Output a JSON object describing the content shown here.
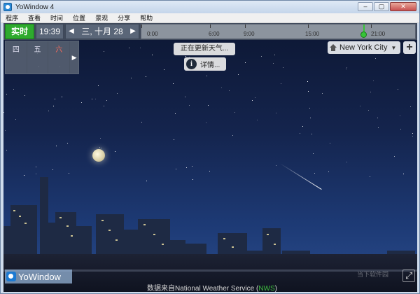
{
  "window": {
    "title": "YoWindow 4",
    "buttons": {
      "minimize": "–",
      "maximize": "▢",
      "close": "✕"
    }
  },
  "menu": [
    "程序",
    "查看",
    "时间",
    "位置",
    "景观",
    "分享",
    "帮助"
  ],
  "timeline": {
    "live_label": "实时",
    "time": "19:39",
    "date": "三, 十月 28",
    "ticks": [
      "0:00",
      "6:00",
      "9:00",
      "15:00",
      "21:00"
    ]
  },
  "forecast": {
    "days": [
      "四",
      "五",
      "六"
    ]
  },
  "status": {
    "updating": "正在更新天气...",
    "details": "详情..."
  },
  "location": {
    "city": "New York City"
  },
  "scene": {
    "sign": "New York City"
  },
  "branding": {
    "logo": "YoWindow"
  },
  "source": {
    "prefix": "数据来自",
    "provider": "National Weather Service",
    "abbr": "NWS"
  },
  "watermark": "当下软件园",
  "colors": {
    "live_green": "#2eaa2e",
    "nws_green": "#3fbf3f",
    "weekend_red": "#ff6b5a"
  }
}
